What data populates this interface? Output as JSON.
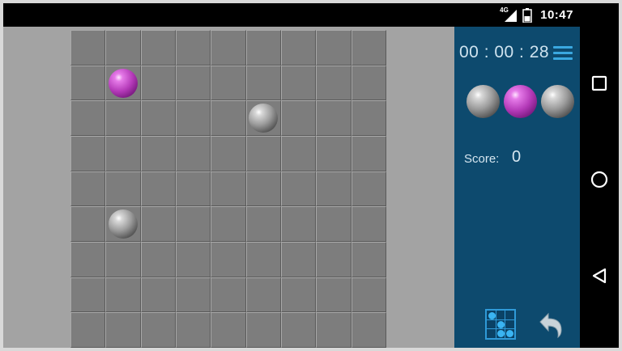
{
  "status_bar": {
    "network_label": "4G",
    "time": "10:47"
  },
  "board": {
    "rows": 9,
    "cols": 9,
    "balls": [
      {
        "row": 1,
        "col": 1,
        "color": "purple"
      },
      {
        "row": 2,
        "col": 5,
        "color": "gray"
      },
      {
        "row": 5,
        "col": 1,
        "color": "gray"
      }
    ]
  },
  "side_panel": {
    "timer": "00 : 00 : 28",
    "next_balls": [
      "gray",
      "purple",
      "gray"
    ],
    "score_label": "Score:",
    "score_value": "0"
  },
  "icons": {
    "menu": "hamburger-menu-icon",
    "hint": "hint-grid-icon",
    "undo": "undo-arrow-icon",
    "nav_recents": "square-icon",
    "nav_home": "circle-icon",
    "nav_back": "triangle-back-icon"
  },
  "colors": {
    "panel_background": "#0d4a6e",
    "accent": "#3aa8e0",
    "board_cell": "#7d7d7d",
    "ball_purple": "#b43ab8",
    "ball_gray": "#9c9c9c"
  }
}
